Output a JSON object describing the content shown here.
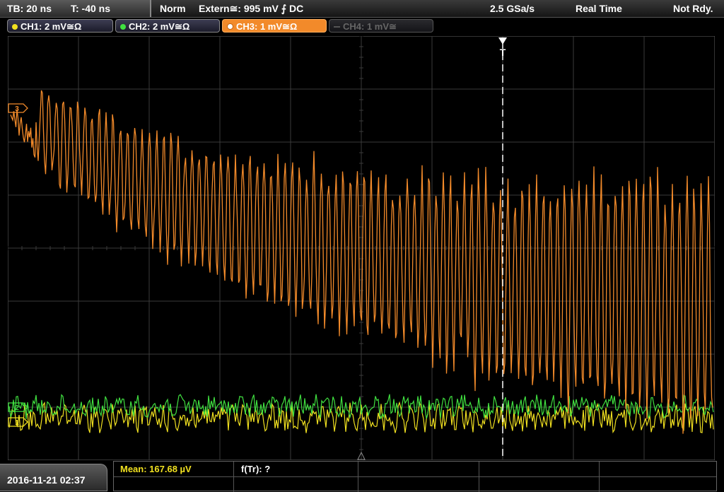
{
  "top_bar": {
    "timebase": "TB: 20 ns",
    "trigger_time": "T: -40 ns",
    "mode": "Norm",
    "trigger_source": "Extern≅: 995 mV ⨍ DC",
    "sample_rate": "2.5 GSa/s",
    "acquisition": "Real Time",
    "status": "Not Rdy."
  },
  "tabs": [
    {
      "label": "CH1: 2 mV≅Ω",
      "color": "#f0e020"
    },
    {
      "label": "CH2: 2 mV≅Ω",
      "color": "#40e040"
    },
    {
      "label": "CH3: 1 mV≅Ω",
      "color": "#f28a2a"
    },
    {
      "label": "CH4: 1 mV≅",
      "color": "#555555"
    }
  ],
  "markers": {
    "trigger_position": "T",
    "ch3_marker": "3",
    "ch2_marker": "2",
    "ch1_marker": "1"
  },
  "colors": {
    "ch1": "#f0e020",
    "ch2": "#40e040",
    "ch3": "#f28a2a",
    "grid": "#3a3a3a"
  },
  "bottom": {
    "datetime": "2016-11-21 02:37",
    "mean": "Mean: 167.68 µV",
    "f_tr": "f(Tr): ?"
  }
}
